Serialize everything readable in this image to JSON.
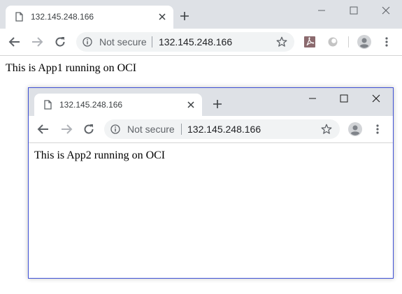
{
  "outer_window": {
    "tab": {
      "title": "132.145.248.166"
    },
    "omnibox": {
      "security_label": "Not secure",
      "url": "132.145.248.166"
    },
    "page": {
      "text": "This is App1 running on OCI"
    },
    "icons": [
      "page-icon",
      "close-icon",
      "plus-icon",
      "minimize-icon",
      "maximize-icon",
      "window-close-icon",
      "back-arrow-icon",
      "forward-arrow-icon",
      "reload-icon",
      "info-icon",
      "star-icon",
      "pdf-extension-icon",
      "extension-icon",
      "profile-avatar-icon",
      "kebab-menu-icon"
    ]
  },
  "inner_window": {
    "tab": {
      "title": "132.145.248.166"
    },
    "omnibox": {
      "security_label": "Not secure",
      "url": "132.145.248.166"
    },
    "page": {
      "text": "This is App2 running on OCI"
    },
    "icons": [
      "page-icon",
      "close-icon",
      "plus-icon",
      "minimize-icon",
      "maximize-icon",
      "window-close-icon",
      "back-arrow-icon",
      "forward-arrow-icon",
      "reload-icon",
      "info-icon",
      "star-icon",
      "profile-avatar-icon",
      "kebab-menu-icon"
    ]
  },
  "colors": {
    "tabstrip_bg": "#dee1e6",
    "omnibox_bg": "#f1f3f4",
    "inner_window_border": "#3f51d6",
    "icon_gray": "#5f6368",
    "forward_disabled": "#b0b3b8"
  }
}
